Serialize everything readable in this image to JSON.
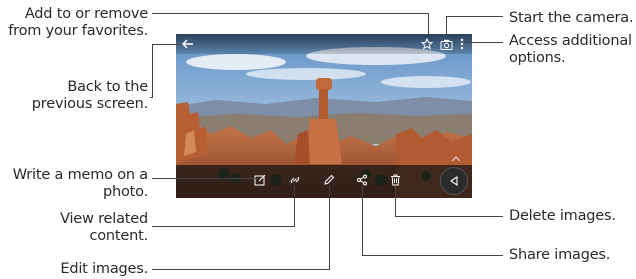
{
  "callouts": {
    "favorites": "Add to or remove\nfrom your favorites.",
    "back": "Back to the\nprevious screen.",
    "memo": "Write a memo on a\nphoto.",
    "related": "View related\ncontent.",
    "edit": "Edit images.",
    "camera": "Start the camera.",
    "options": "Access additional\noptions.",
    "delete": "Delete images.",
    "share": "Share images."
  },
  "screen": {
    "top_icons": [
      "back-arrow-icon",
      "star-icon",
      "camera-icon",
      "more-options-icon"
    ],
    "bottom_icons": [
      "memo-icon",
      "related-content-icon",
      "edit-icon",
      "share-icon",
      "delete-icon",
      "nav-back-icon"
    ]
  },
  "colors": {
    "text": "#2a2a2a",
    "line": "#444444",
    "bar": "#141414"
  }
}
